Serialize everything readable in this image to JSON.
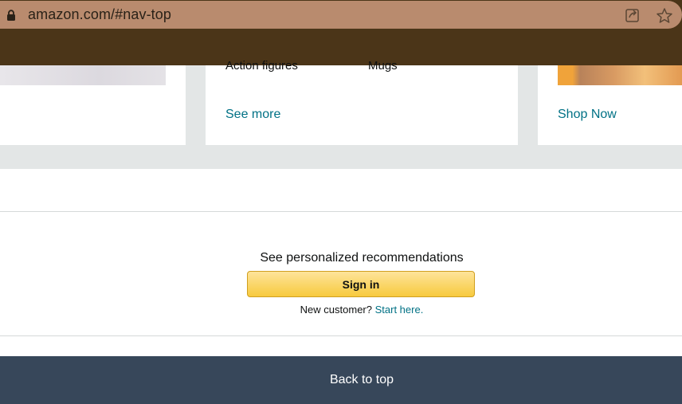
{
  "browser": {
    "url": "amazon.com/#nav-top",
    "icons": [
      "lock-icon",
      "share-icon",
      "star-icon"
    ]
  },
  "cards": {
    "middle": {
      "categories": [
        "Action figures",
        "Mugs"
      ],
      "link": "See more"
    },
    "right": {
      "link": "Shop Now"
    }
  },
  "signin": {
    "prompt": "See personalized recommendations",
    "button": "Sign in",
    "new_customer": "New customer?",
    "start_here": "Start here."
  },
  "footer": {
    "back_to_top": "Back to top"
  },
  "colors": {
    "link": "#007185",
    "button_yellow": "#f7ca3e",
    "footer_bg": "#37475a",
    "browser_bar": "#4b3518"
  }
}
